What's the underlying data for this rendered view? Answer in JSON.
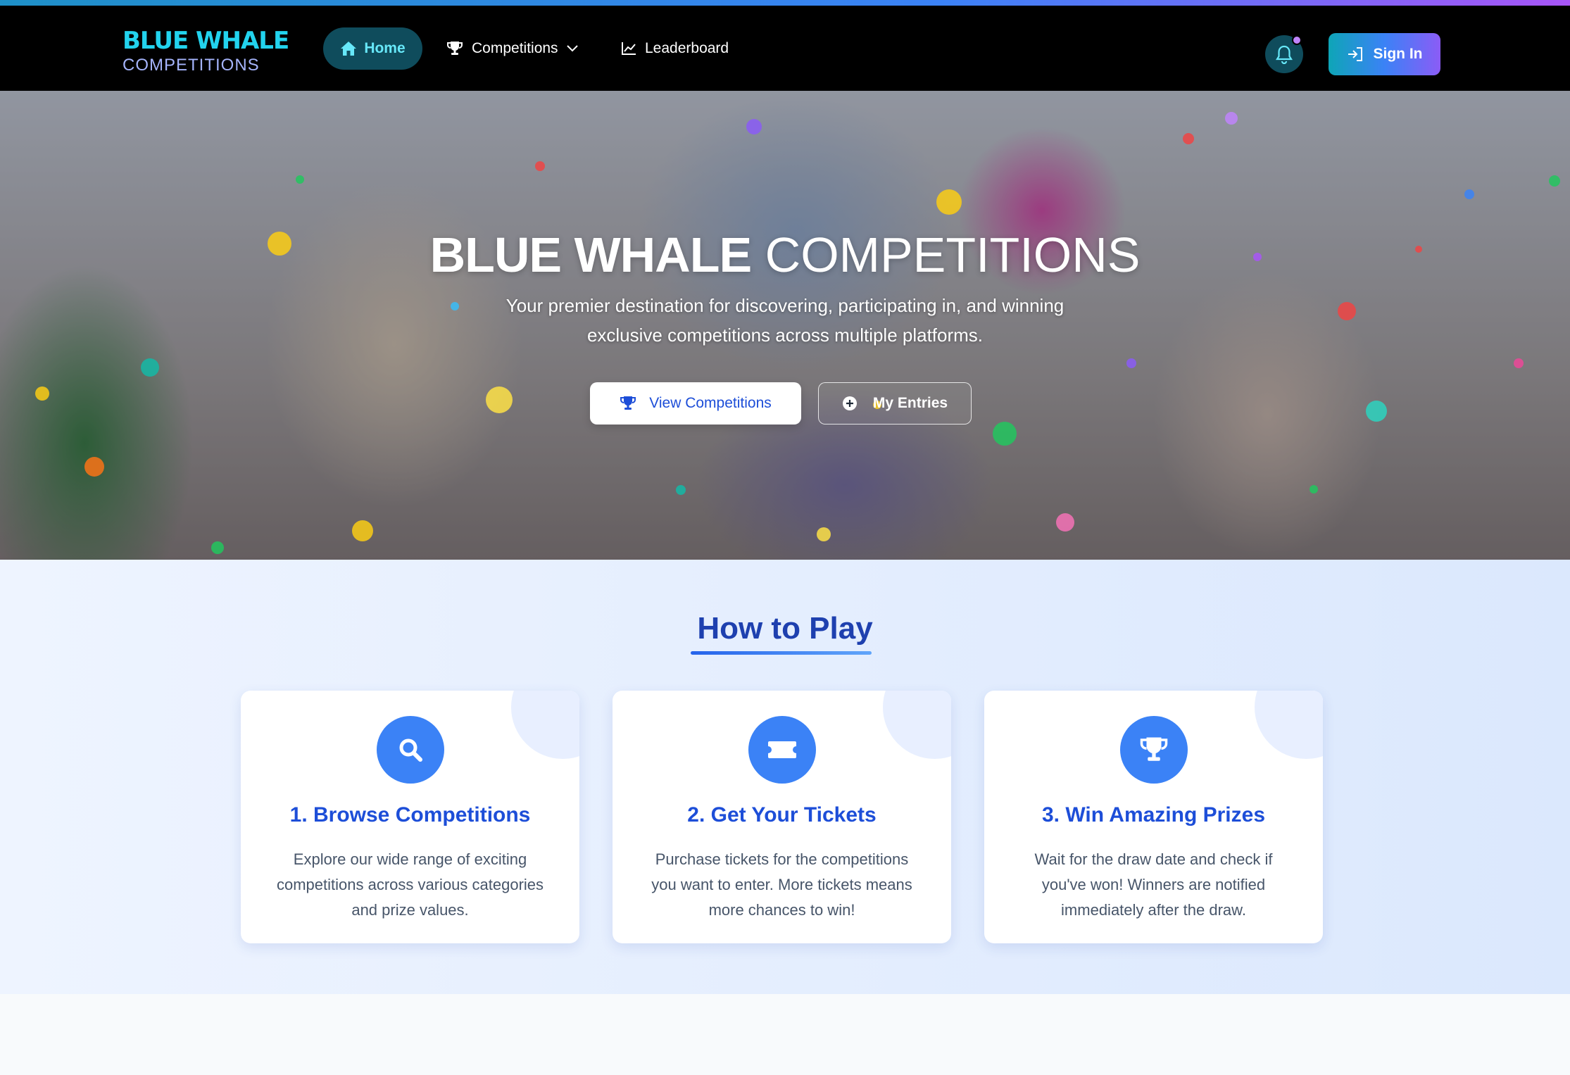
{
  "brand": {
    "main": "BLUE WHALE",
    "sub": "COMPETITIONS"
  },
  "nav": {
    "home": "Home",
    "competitions": "Competitions",
    "leaderboard": "Leaderboard",
    "sign_in": "Sign In"
  },
  "hero": {
    "title_bold": "BLUE WHALE",
    "title_light": "COMPETITIONS",
    "subtitle": "Your premier destination for discovering, participating in, and winning exclusive competitions across multiple platforms.",
    "view_button": "View Competitions",
    "entries_button": "My Entries"
  },
  "how": {
    "title": "How to Play",
    "cards": [
      {
        "icon": "search-icon",
        "title": "1. Browse Competitions",
        "text": "Explore our wide range of exciting competitions across various categories and prize values."
      },
      {
        "icon": "ticket-icon",
        "title": "2. Get Your Tickets",
        "text": "Purchase tickets for the competitions you want to enter. More tickets means more chances to win!"
      },
      {
        "icon": "trophy-icon",
        "title": "3. Win Amazing Prizes",
        "text": "Wait for the draw date and check if you've won! Winners are notified immediately after the draw."
      }
    ]
  },
  "colors": {
    "accent": "#3b82f6",
    "brand_cyan": "#22d3ee",
    "heading_blue": "#1e40af"
  }
}
